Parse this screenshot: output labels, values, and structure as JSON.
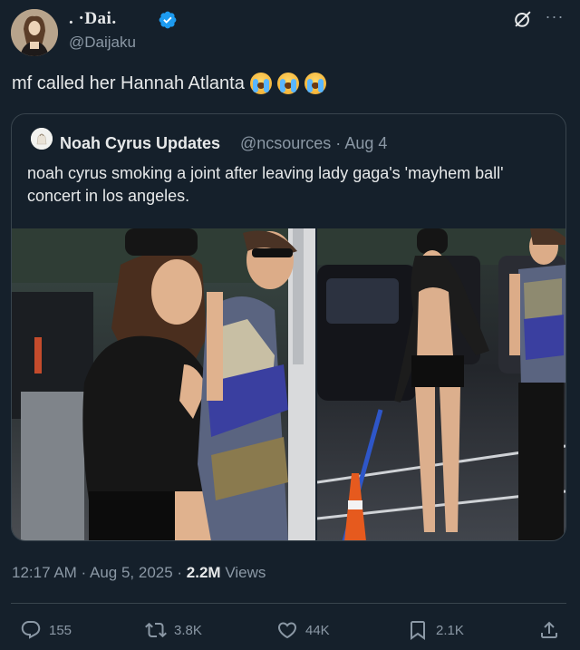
{
  "author": {
    "display_name": ". ·Dai.",
    "handle": "@Daijaku",
    "verified": true
  },
  "tweet_text": "mf called her Hannah Atlanta",
  "emoji_name": "loudly-crying-face",
  "quote": {
    "name": "Noah Cyrus Updates",
    "handle_date": "@ncsources · Aug 4",
    "text": "noah cyrus smoking a joint after leaving lady gaga's 'mayhem ball' concert in los angeles."
  },
  "meta": {
    "timestamp": "12:17 AM · Aug 5, 2025 · ",
    "views_count": "2.2M",
    "views_label": " Views"
  },
  "actions": {
    "replies": "155",
    "reposts": "3.8K",
    "likes": "44K",
    "bookmarks": "2.1K"
  },
  "colors": {
    "background": "#15202b",
    "text_primary": "#e7e9ea",
    "text_secondary": "#8b98a5",
    "border": "#38444d",
    "verified_blue": "#1d9bf0"
  }
}
